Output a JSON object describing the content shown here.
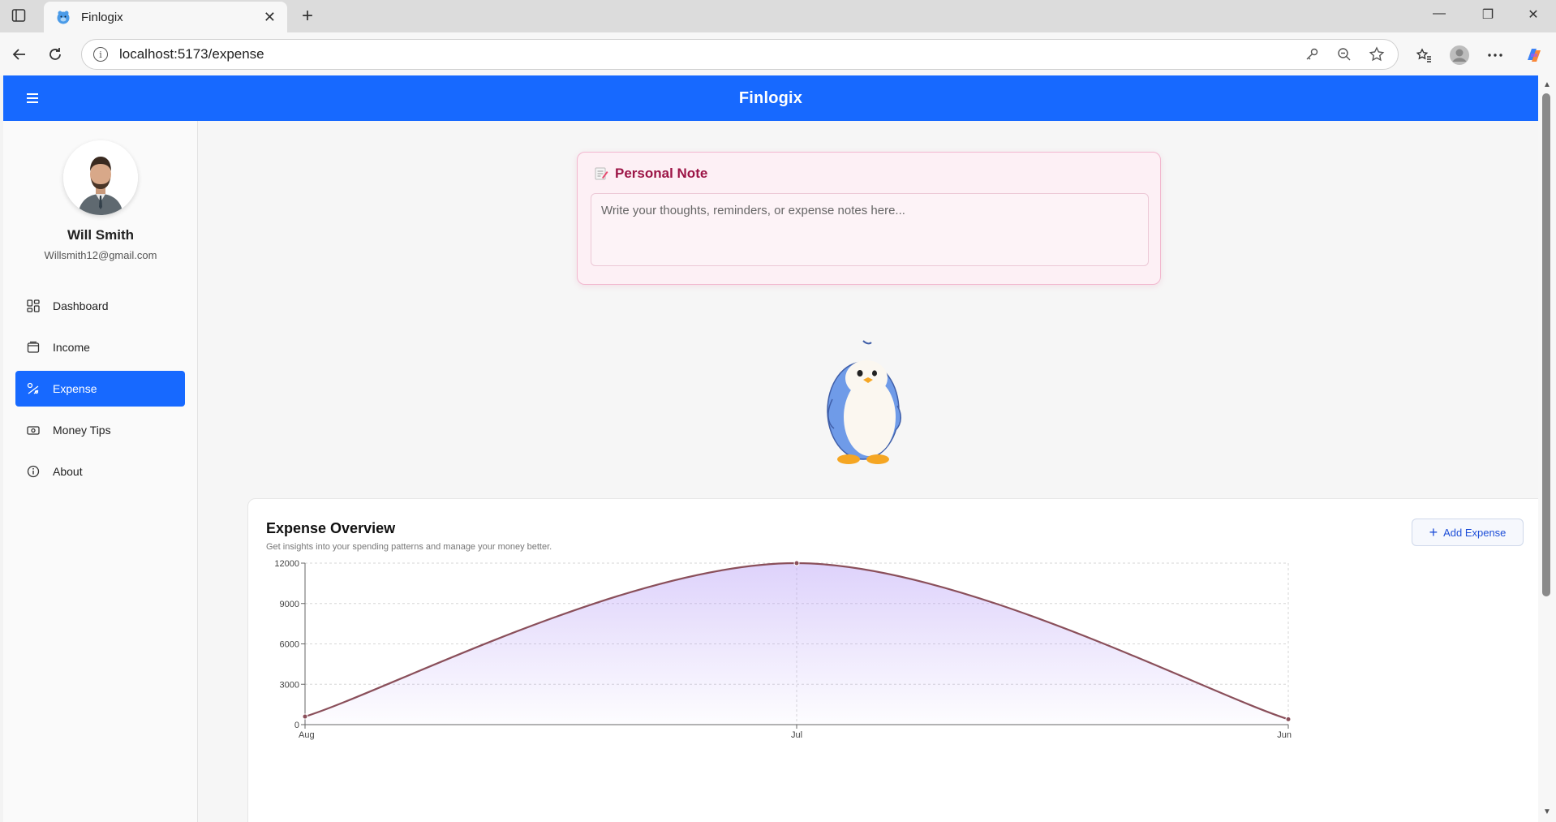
{
  "browser": {
    "tab_title": "Finlogix",
    "url": "localhost:5173/expense"
  },
  "app": {
    "brand": "Finlogix"
  },
  "user": {
    "name": "Will Smith",
    "email": "Willsmith12@gmail.com"
  },
  "sidebar": {
    "items": [
      {
        "label": "Dashboard",
        "icon": "dashboard-icon",
        "active": false
      },
      {
        "label": "Income",
        "icon": "wallet-icon",
        "active": false
      },
      {
        "label": "Expense",
        "icon": "expense-icon",
        "active": true
      },
      {
        "label": "Money Tips",
        "icon": "money-icon",
        "active": false
      },
      {
        "label": "About",
        "icon": "info-icon",
        "active": false
      }
    ]
  },
  "note": {
    "title": "Personal Note",
    "placeholder": "Write your thoughts, reminders, or expense notes here..."
  },
  "expense": {
    "title": "Expense Overview",
    "subtitle": "Get insights into your spending patterns and manage your money better.",
    "add_button": "Add Expense"
  },
  "colors": {
    "primary": "#1769ff",
    "line": "#8a4f5a",
    "area": "#b59bf6",
    "note_title": "#9c1546"
  },
  "chart_data": {
    "type": "area",
    "categories": [
      "Aug",
      "Jul",
      "Jun"
    ],
    "series": [
      {
        "values": [
          600,
          12000,
          400
        ]
      }
    ],
    "yticks": [
      0,
      3000,
      6000,
      9000,
      12000
    ],
    "ylim": [
      0,
      12000
    ],
    "grid": true,
    "smooth": true
  }
}
